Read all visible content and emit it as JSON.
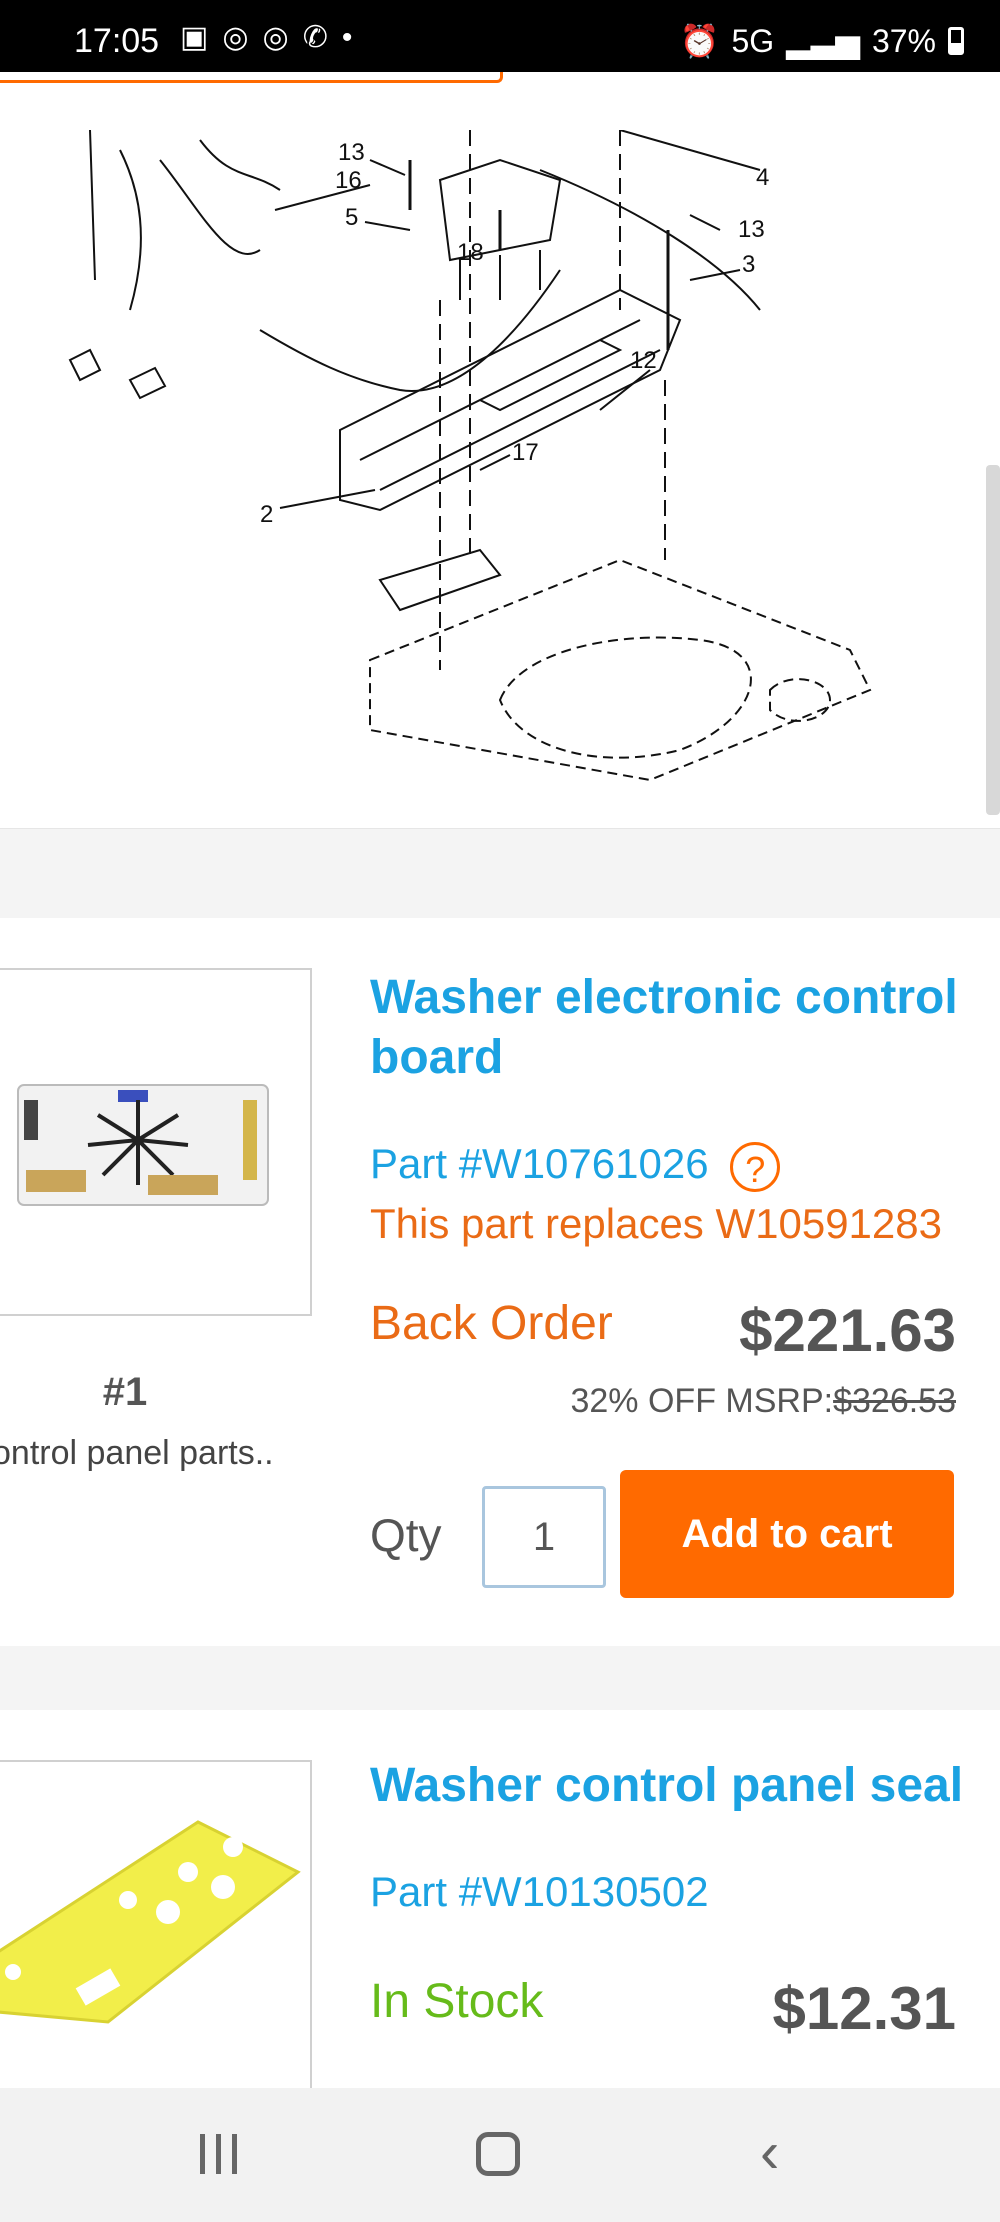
{
  "status_bar": {
    "time": "17:05",
    "network": "5G",
    "battery": "37%"
  },
  "diagram": {
    "callouts": [
      "13",
      "16",
      "5",
      "18",
      "4",
      "13",
      "3",
      "12",
      "17",
      "2"
    ]
  },
  "products": [
    {
      "title": "Washer electronic control board",
      "part_number": "Part #W10761026",
      "help_symbol": "?",
      "replaces": "This part replaces W10591283",
      "availability": "Back Order",
      "availability_color": "#ea6b16",
      "price": "$221.63",
      "discount_prefix": "32% OFF MSRP:",
      "msrp": "$326.53",
      "rank": "#1",
      "caption": "ontrol panel parts..",
      "qty_label": "Qty",
      "qty_value": "1",
      "add_to_cart_label": "Add to cart"
    },
    {
      "title": "Washer control panel seal",
      "part_number": "Part #W10130502",
      "availability": "In Stock",
      "availability_color": "#66bb1a",
      "price": "$12.31"
    }
  ],
  "colors": {
    "accent_blue": "#1ba2e2",
    "accent_orange": "#ff6a00"
  },
  "navbar": {
    "icons": [
      "recents-icon",
      "home-icon",
      "back-icon"
    ]
  }
}
